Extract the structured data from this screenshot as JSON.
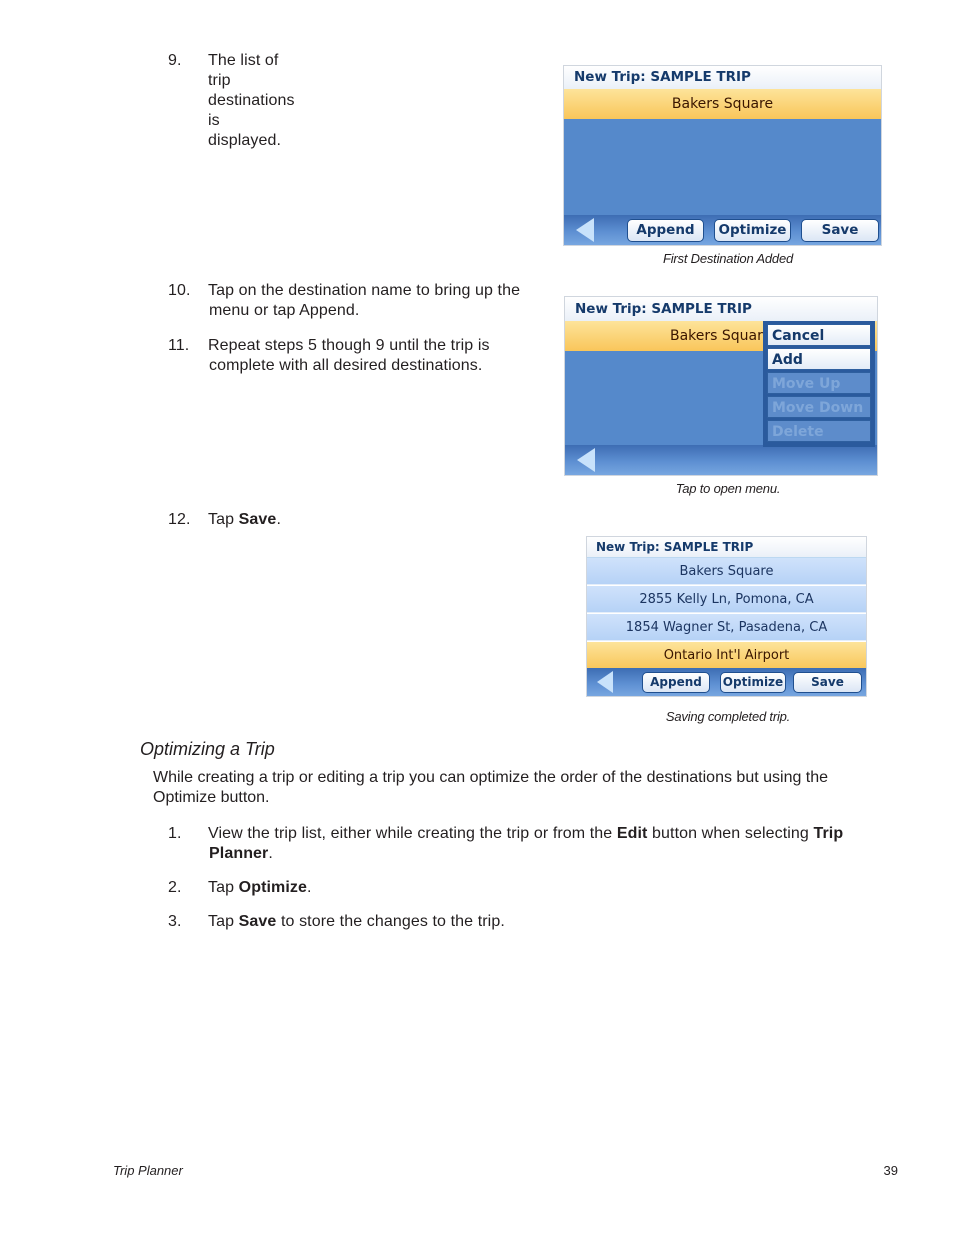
{
  "steps_top": [
    {
      "num": "9.",
      "text": "The list of trip destinations is displayed."
    },
    {
      "num": "10.",
      "line1": "Tap on the destination name to bring up the",
      "line2": "menu or tap Append."
    },
    {
      "num": "11.",
      "line1": "Repeat steps 5 though 9 until the trip is",
      "line2": "complete with all desired destinations."
    },
    {
      "num": "12.",
      "pre": "Tap ",
      "bold": "Save",
      "post": "."
    }
  ],
  "screen1": {
    "title": "New Trip: SAMPLE TRIP",
    "selected_row": "Bakers Square",
    "buttons": {
      "append": "Append",
      "optimize": "Optimize",
      "save": "Save"
    },
    "caption": "First Destination Added"
  },
  "screen2": {
    "title": "New Trip: SAMPLE TRIP",
    "selected_row": "Bakers Squar",
    "menu": [
      {
        "label": "Cancel",
        "enabled": true
      },
      {
        "label": "Add",
        "enabled": true
      },
      {
        "label": "Move Up",
        "enabled": false
      },
      {
        "label": "Move Down",
        "enabled": false
      },
      {
        "label": "Delete",
        "enabled": false
      }
    ],
    "caption": "Tap to open menu."
  },
  "screen3": {
    "title": "New Trip: SAMPLE TRIP",
    "rows": [
      "Bakers Square",
      "2855 Kelly Ln, Pomona, CA",
      "1854 Wagner St, Pasadena, CA"
    ],
    "selected_row": "Ontario Int'l Airport",
    "buttons": {
      "append": "Append",
      "optimize": "Optimize",
      "save": "Save"
    },
    "caption": "Saving completed trip."
  },
  "section": {
    "title": "Optimizing a Trip",
    "paragraph": "While creating a trip or editing a trip you can optimize the order of the destinations but using the Optimize button.",
    "steps": [
      {
        "num": "1.",
        "pre": "View the trip list, either while creating the trip or from the ",
        "bold1": "Edit",
        "mid": " button when selecting ",
        "bold2": "Trip",
        "line2_bold": "Planner",
        "line2_post": "."
      },
      {
        "num": "2.",
        "pre": "Tap ",
        "bold": "Optimize",
        "post": "."
      },
      {
        "num": "3.",
        "pre": "Tap ",
        "bold": "Save",
        "post": " to store the changes to the trip."
      }
    ]
  },
  "footer": {
    "section": "Trip Planner",
    "page": "39"
  }
}
